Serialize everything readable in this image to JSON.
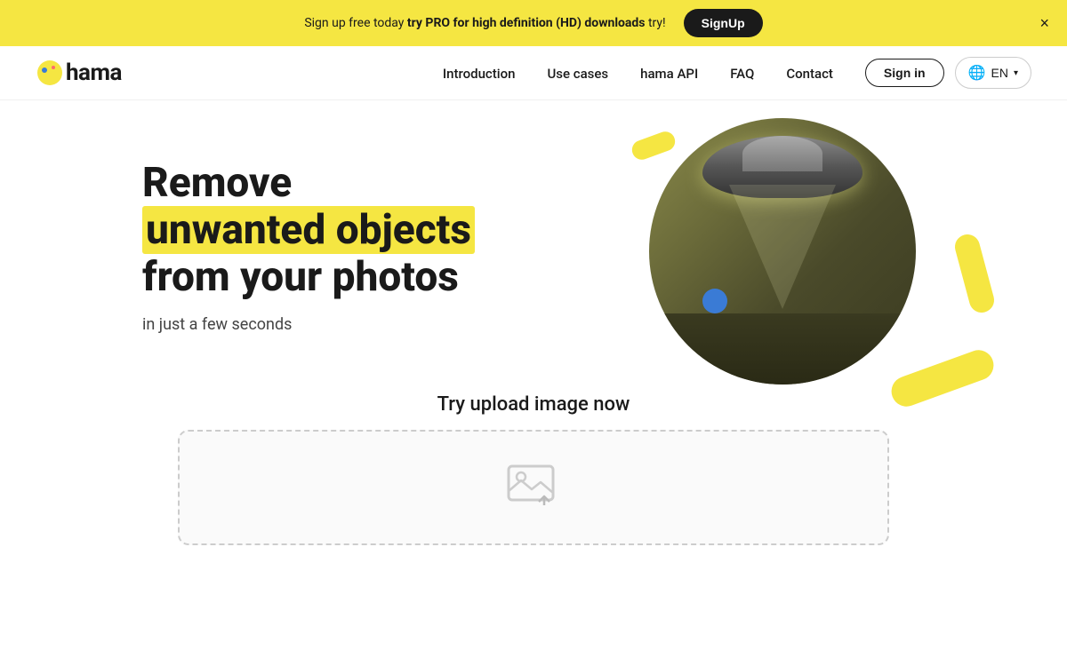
{
  "banner": {
    "text_before": "Sign up free today ",
    "text_bold": "try PRO for high definition (HD) downloads",
    "text_after": " try!",
    "signup_label": "SignUp",
    "close_label": "×"
  },
  "nav": {
    "logo_text": "hama",
    "links": [
      {
        "label": "Introduction",
        "href": "#"
      },
      {
        "label": "Use cases",
        "href": "#"
      },
      {
        "label": "hama API",
        "href": "#"
      },
      {
        "label": "FAQ",
        "href": "#"
      },
      {
        "label": "Contact",
        "href": "#"
      }
    ],
    "signin_label": "Sign in",
    "lang_label": "EN"
  },
  "hero": {
    "title_line1": "Remove",
    "title_highlight": "unwanted objects",
    "title_line3": "from your photos",
    "subtitle": "in just a few seconds"
  },
  "upload": {
    "title": "Try upload image now"
  }
}
